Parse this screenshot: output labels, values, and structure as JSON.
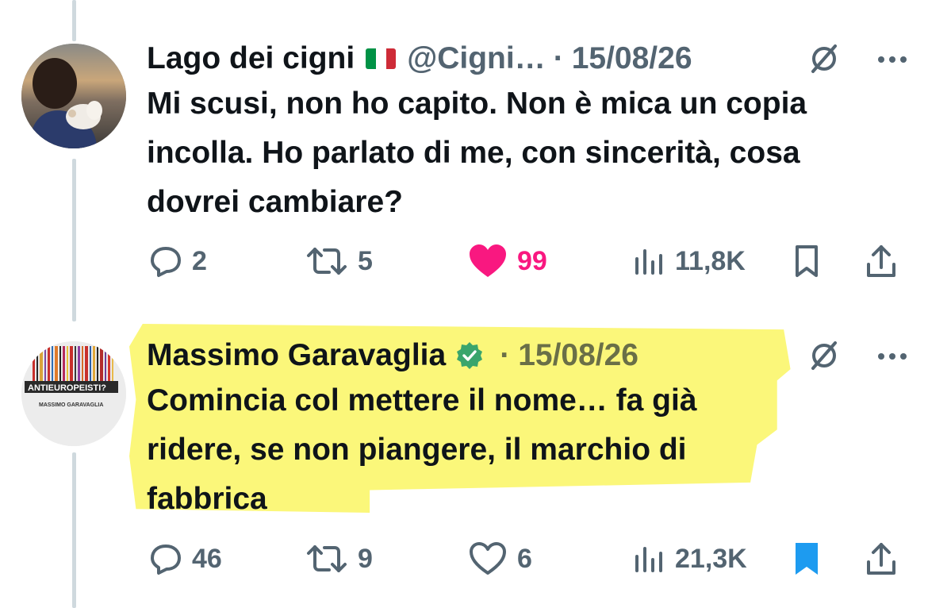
{
  "tweets": [
    {
      "author": "Lago dei cigni",
      "handle": "@Cigni…",
      "separator": "·",
      "date": "15/08/26",
      "text": "Mi scusi, non ho capito. Non è mica un copia incolla. Ho parlato di me, con sincerità, cosa dovrei cambiare?",
      "flag_colors": [
        "#009246",
        "#ffffff",
        "#ce2b37"
      ],
      "replies": "2",
      "reposts": "5",
      "likes": "99",
      "liked": true,
      "views": "11,8K",
      "bookmarked": false
    },
    {
      "author": "Massimo Garavaglia",
      "verified": true,
      "separator": "·",
      "date": "15/08/26",
      "text": "Comincia col mettere il nome… fa già ridere, se non piangere, il marchio di fabbrica",
      "avatar_banner": "ANTIEUROPEISTI?",
      "avatar_caption": "MASSIMO GARAVAGLIA",
      "replies": "46",
      "reposts": "9",
      "likes": "6",
      "liked": false,
      "views": "21,3K",
      "bookmarked": true
    }
  ],
  "colors": {
    "like_active": "#f91880",
    "bookmark_active": "#1d9bf0",
    "verified_badge": "#00ba7c",
    "muted": "#536471",
    "highlight": "#fbf77a"
  },
  "icons": [
    "reply-icon",
    "repost-icon",
    "like-icon",
    "views-icon",
    "bookmark-icon",
    "share-icon",
    "grok-icon",
    "more-icon",
    "verified-badge-icon"
  ]
}
